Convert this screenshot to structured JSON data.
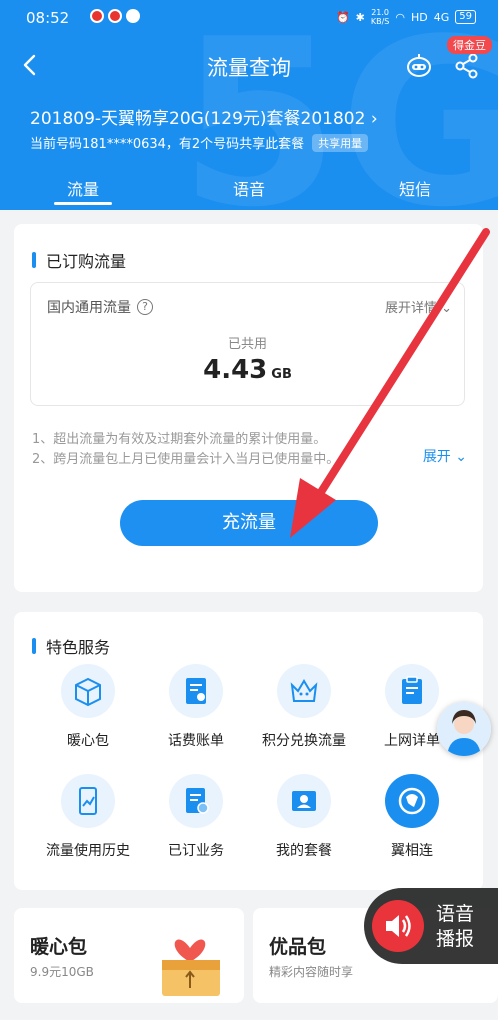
{
  "status_bar": {
    "time": "08:52",
    "speed_value": "21.0",
    "speed_unit": "KB/S",
    "hd": "HD",
    "network": "4G",
    "battery": "59"
  },
  "nav": {
    "title": "流量查询",
    "coin_badge": "得金豆"
  },
  "plan": {
    "name": "201809-天翼畅享20G(129元)套餐201802",
    "current_number": "当前号码181****0634，有2个号码共享此套餐",
    "share_tag": "共享用量"
  },
  "tabs": [
    {
      "label": "流量",
      "active": true
    },
    {
      "label": "语音",
      "active": false
    },
    {
      "label": "短信",
      "active": false
    }
  ],
  "subscribed": {
    "title": "已订购流量",
    "domestic_label": "国内通用流量",
    "expand_detail": "展开详情",
    "shared_label": "已共用",
    "usage_value": "4.43",
    "usage_unit": "GB",
    "note1": "1、超出流量为有效及过期套外流量的累计使用量。",
    "note2": "2、跨月流量包上月已使用量会计入当月已使用量中。",
    "expand": "展开",
    "recharge_button": "充流量"
  },
  "services": {
    "title": "特色服务",
    "items": [
      {
        "label": "暖心包",
        "icon": "box-icon"
      },
      {
        "label": "话费账单",
        "icon": "bill-icon"
      },
      {
        "label": "积分兑换流量",
        "icon": "crown-icon"
      },
      {
        "label": "上网详单",
        "icon": "clipboard-icon"
      },
      {
        "label": "流量使用历史",
        "icon": "phone-chart-icon"
      },
      {
        "label": "已订业务",
        "icon": "doc-check-icon"
      },
      {
        "label": "我的套餐",
        "icon": "profile-card-icon"
      },
      {
        "label": "翼相连",
        "icon": "phone-link-icon"
      }
    ]
  },
  "promos": [
    {
      "title": "暖心包",
      "sub": "9.9元10GB"
    },
    {
      "title": "优品包",
      "sub": "精彩内容随时享"
    }
  ],
  "voice": {
    "line1": "语音",
    "line2": "播报"
  },
  "colors": {
    "primary": "#1b8ff0",
    "badge": "#f1494e",
    "arrow": "#e8343f"
  }
}
